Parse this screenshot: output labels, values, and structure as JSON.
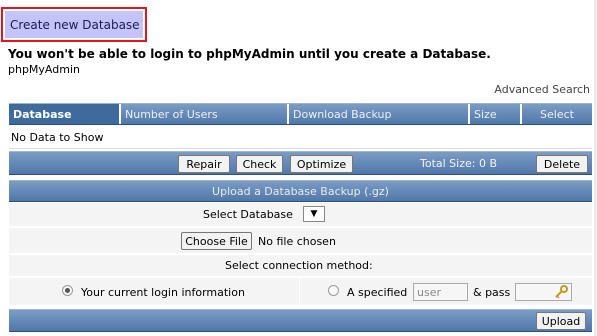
{
  "create_button": "Create new Database",
  "warning": "You won't be able to login to phpMyAdmin until you create a Database.",
  "subtitle": "phpMyAdmin",
  "advanced_search": "Advanced Search",
  "table": {
    "columns": [
      "Database",
      "Number of Users",
      "Download Backup",
      "Size",
      "Select"
    ],
    "empty_message": "No Data to Show"
  },
  "actions": {
    "repair": "Repair",
    "check": "Check",
    "optimize": "Optimize",
    "total_size": "Total Size: 0 B",
    "delete": "Delete"
  },
  "upload": {
    "title": "Upload a Database Backup (.gz)",
    "select_db_label": "Select Database",
    "select_db_arrow": "▼",
    "choose_file": "Choose File",
    "no_file": "No file chosen",
    "connection_label": "Select connection method:",
    "option_current": "Your current login information",
    "option_specified": "A specified",
    "user_placeholder": "user",
    "pass_label": "& pass",
    "upload_button": "Upload"
  },
  "colors": {
    "create_bg": "#c4c4fb",
    "create_border": "#e4151f",
    "bar_blue": "#5a80b0"
  }
}
